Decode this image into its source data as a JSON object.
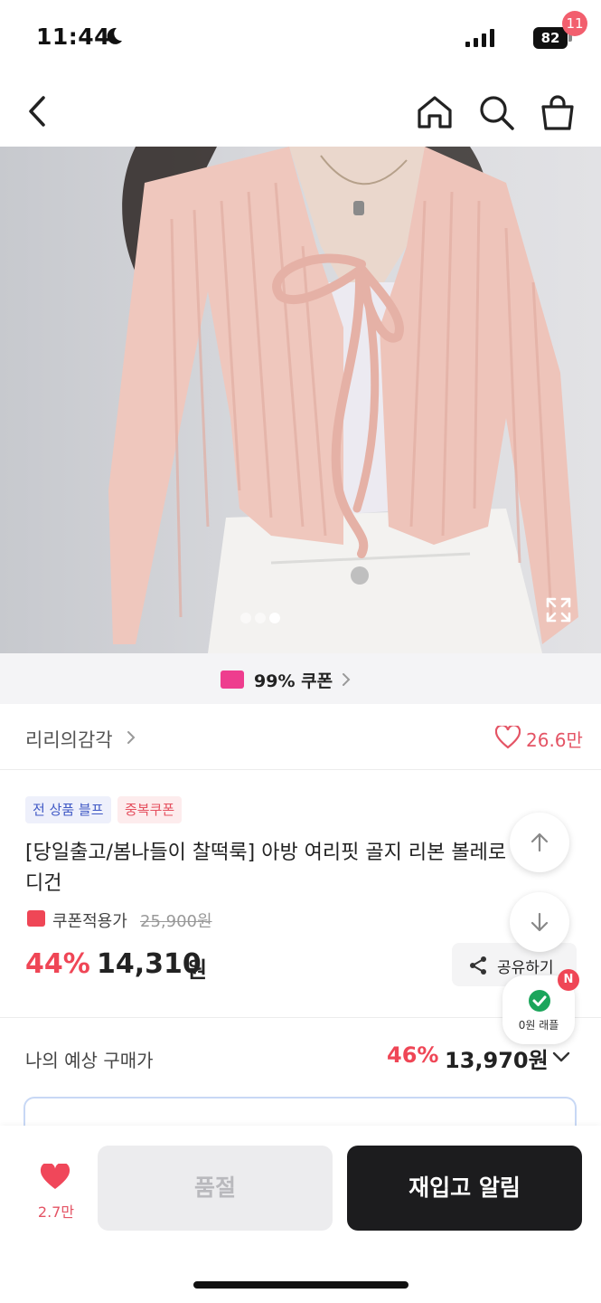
{
  "status_bar": {
    "time": "11:44",
    "battery": "82",
    "icons": [
      "moon-icon",
      "signal-icon",
      "battery-icon"
    ]
  },
  "nav": {
    "icons": [
      "back-icon",
      "home-icon",
      "search-icon",
      "cart-icon"
    ],
    "cart_badge": "11"
  },
  "gallery": {
    "image_count": 3,
    "active_index": 1,
    "icons": [
      "expand-icon"
    ]
  },
  "coupon_banner": {
    "text": "99% 쿠폰",
    "icon": "coupon-icon"
  },
  "brand": {
    "name": "리리의감각",
    "likes": "26.6만"
  },
  "tags": [
    "전 상품 블프",
    "중복쿠폰"
  ],
  "product": {
    "title": "[당일출고/봄나들이 찰떡룩] 아방 여리핏 골지 리본 볼레로 가디건",
    "coupon_label": "쿠폰적용가",
    "original_price": "25,900원",
    "discount": "44%",
    "price": "14,310",
    "price_unit": "원"
  },
  "share": {
    "label": "공유하기"
  },
  "estimate": {
    "label": "나의 예상 구매가",
    "discount": "46%",
    "price": "13,970원"
  },
  "floating": {
    "raffle_label": "0원 래플",
    "raffle_badge": "N"
  },
  "bottom_bar": {
    "wish_count": "2.7만",
    "soldout_label": "품절",
    "restock_label": "재입고 알림"
  },
  "colors": {
    "accent_red": "#ef4656",
    "like_pink": "#e45465",
    "coupon_pink": "#ee3d8e",
    "tag_blue": "#4059c5",
    "dark_button": "#1c1c1e"
  }
}
